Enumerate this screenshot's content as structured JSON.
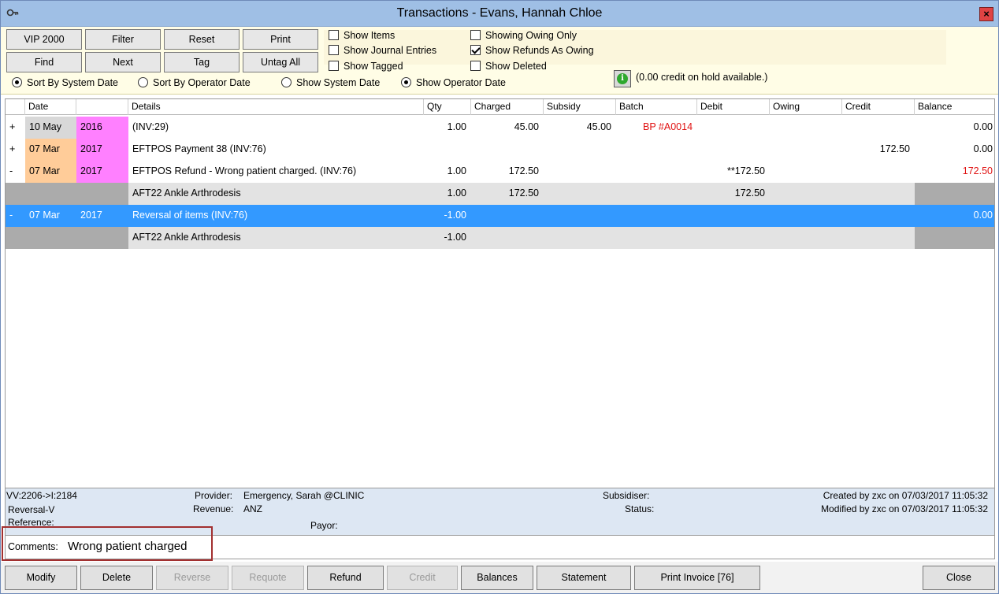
{
  "window": {
    "title": "Transactions - Evans, Hannah Chloe",
    "close_label": "×"
  },
  "toolbar": {
    "buttons": [
      "VIP 2000",
      "Filter",
      "Reset",
      "Print",
      "Find",
      "Next",
      "Tag",
      "Untag All"
    ],
    "checkboxes": [
      {
        "label": "Show Items",
        "checked": false
      },
      {
        "label": "Show Journal Entries",
        "checked": false
      },
      {
        "label": "Show Tagged",
        "checked": false
      },
      {
        "label": "Showing Owing Only",
        "checked": false
      },
      {
        "label": "Show Refunds As Owing",
        "checked": true
      },
      {
        "label": "Show Deleted",
        "checked": false
      }
    ],
    "radios": [
      {
        "label": "Sort By System Date",
        "on": true
      },
      {
        "label": "Sort By Operator Date",
        "on": false
      },
      {
        "label": "Show System Date",
        "on": false
      },
      {
        "label": "Show Operator Date",
        "on": true
      }
    ],
    "info_icon_glyph": "i",
    "info_text": "(0.00 credit on hold available.)"
  },
  "grid": {
    "columns": [
      "",
      "Date",
      "",
      "Details",
      "Qty",
      "Charged",
      "Subsidy",
      "Batch",
      "Debit",
      "Owing",
      "Credit",
      "Balance"
    ],
    "rows": [
      {
        "kind": "main",
        "expander": "+",
        "date": "10 May",
        "year": "2016",
        "details": "(INV:29)",
        "qty": "1.00",
        "charged": "45.00",
        "subsidy": "45.00",
        "batch": "BP #A0014",
        "debit": "",
        "owing": "",
        "credit": "",
        "balance": "0.00",
        "date_bg": "#d8d8d8",
        "year_bg": "#ff80ff",
        "balance_red": false
      },
      {
        "kind": "main",
        "expander": "+",
        "date": "07 Mar",
        "year": "2017",
        "details": "EFTPOS Payment  38  (INV:76)",
        "qty": "",
        "charged": "",
        "subsidy": "",
        "batch": "",
        "debit": "",
        "owing": "",
        "credit": "172.50",
        "balance": "0.00",
        "date_bg": "#ffcc99",
        "year_bg": "#ff80ff",
        "balance_red": false
      },
      {
        "kind": "main",
        "expander": "-",
        "date": "07 Mar",
        "year": "2017",
        "details": "EFTPOS Refund - Wrong patient charged.  (INV:76)",
        "qty": "1.00",
        "charged": "172.50",
        "subsidy": "",
        "batch": "",
        "debit": "**172.50",
        "owing": "",
        "credit": "",
        "balance": "172.50",
        "date_bg": "#ffcc99",
        "year_bg": "#ff80ff",
        "balance_red": true
      },
      {
        "kind": "sub",
        "expander": "",
        "date": "",
        "year": "",
        "details": "AFT22 Ankle Arthrodesis",
        "qty": "1.00",
        "charged": "172.50",
        "subsidy": "",
        "batch": "",
        "debit": "172.50",
        "owing": "",
        "credit": "",
        "balance": "",
        "date_bg": "#ababab",
        "year_bg": "#ababab",
        "balance_red": false
      },
      {
        "kind": "sel",
        "expander": "-",
        "date": "07 Mar",
        "year": "2017",
        "details": "Reversal of items (INV:76)",
        "qty": "-1.00",
        "charged": "",
        "subsidy": "",
        "batch": "",
        "debit": "",
        "owing": "",
        "credit": "",
        "balance": "0.00",
        "date_bg": "",
        "year_bg": "",
        "balance_red": false
      },
      {
        "kind": "sub",
        "expander": "",
        "date": "",
        "year": "",
        "details": "AFT22 Ankle Arthrodesis",
        "qty": "-1.00",
        "charged": "",
        "subsidy": "",
        "batch": "",
        "debit": "",
        "owing": "",
        "credit": "",
        "balance": "",
        "date_bg": "#ababab",
        "year_bg": "#ababab",
        "balance_red": false
      }
    ]
  },
  "info": {
    "vv": "VV:2206->I:2184",
    "type": "Reversal-V",
    "reference_label": "Reference:",
    "provider_label": "Provider:",
    "provider_value": "Emergency, Sarah @CLINIC",
    "revenue_label": "Revenue:",
    "revenue_value": "ANZ",
    "payor_label": "Payor:",
    "subsidiser_label": "Subsidiser:",
    "status_label": "Status:",
    "created": "Created by zxc on 07/03/2017 11:05:32",
    "modified": "Modified by zxc on 07/03/2017 11:05:32"
  },
  "comments": {
    "label": "Comments:",
    "value": "Wrong patient charged"
  },
  "bottom_buttons": [
    {
      "label": "Modify",
      "disabled": false
    },
    {
      "label": "Delete",
      "disabled": false
    },
    {
      "label": "Reverse",
      "disabled": true
    },
    {
      "label": "Requote",
      "disabled": true
    },
    {
      "label": "Refund",
      "disabled": false
    },
    {
      "label": "Credit",
      "disabled": true
    },
    {
      "label": "Balances",
      "disabled": false
    },
    {
      "label": "Statement",
      "disabled": false
    },
    {
      "label": "Print Invoice [76]",
      "disabled": false
    },
    {
      "label": "Close",
      "disabled": false
    }
  ]
}
